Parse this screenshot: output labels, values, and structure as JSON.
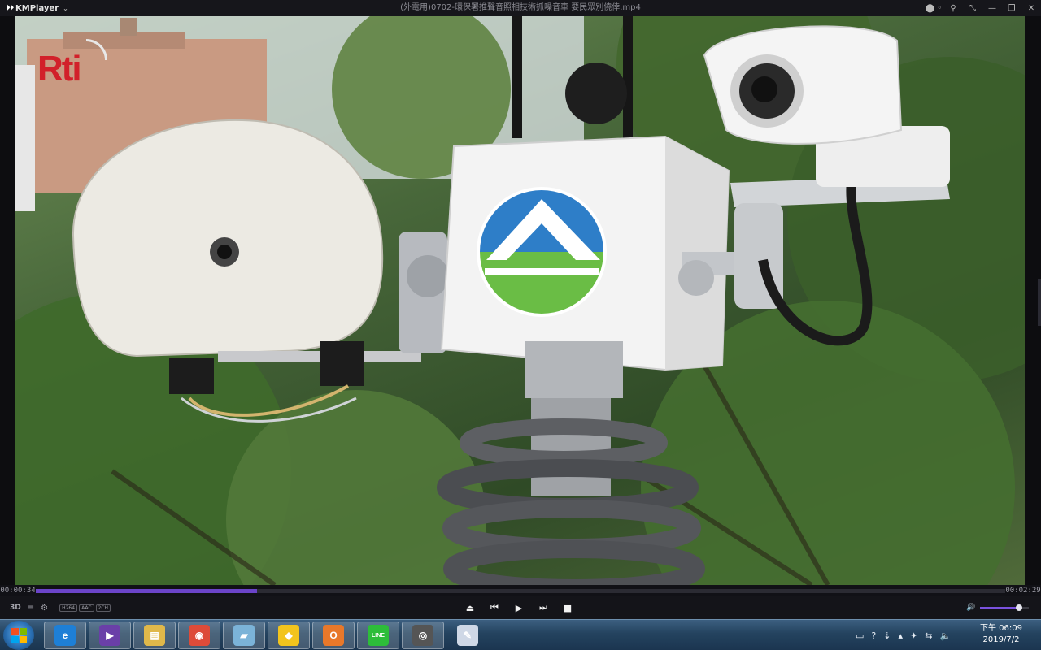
{
  "app": {
    "brand": "KMPlayer",
    "logo_glyph": "⏵⏵",
    "title": "(外電用)0702-環保署推聲音照相技術抓噪音車 要民眾別僥倖.mp4",
    "window_controls": [
      "⬤ ◦",
      "⚲",
      "⤡",
      "—",
      "❐",
      "✕"
    ]
  },
  "video": {
    "watermark": "Rti",
    "scene": "environmental noise camera mast"
  },
  "playback": {
    "current_time": "00:00:34",
    "total_time": "00:02:29",
    "progress": 0.228,
    "volume": 0.8
  },
  "controls": {
    "left": {
      "mode_3d": "3D",
      "playlist": "≡",
      "settings": "⚙",
      "codecs": [
        "H264",
        "AAC",
        "2CH"
      ]
    },
    "center": [
      "⏏",
      "⏮",
      "▶",
      "⏭",
      "■"
    ],
    "volume_icon": "🔊"
  },
  "taskbar": {
    "apps": [
      {
        "name": "ie",
        "glyph": "e",
        "color": "#1e7fd6"
      },
      {
        "name": "kmplayer",
        "glyph": "▶",
        "color": "#6a3fa8"
      },
      {
        "name": "explorer",
        "glyph": "▤",
        "color": "#e0b84a"
      },
      {
        "name": "chrome",
        "glyph": "◉",
        "color": "#dd4b39"
      },
      {
        "name": "media",
        "glyph": "▰",
        "color": "#7bb3d8"
      },
      {
        "name": "potplayer",
        "glyph": "◆",
        "color": "#f2c41d"
      },
      {
        "name": "outlook",
        "glyph": "O",
        "color": "#e8782a"
      },
      {
        "name": "line",
        "glyph": "LINE",
        "color": "#2dbd3a"
      },
      {
        "name": "viewer",
        "glyph": "◎",
        "color": "#555555"
      },
      {
        "name": "paint",
        "glyph": "✎",
        "color": "#cfd8e6"
      }
    ],
    "tray": [
      "▭",
      "?",
      "⇣",
      "▴",
      "✦",
      "⇆",
      "🔈"
    ],
    "clock_time": "下午 06:09",
    "clock_date": "2019/7/2"
  },
  "colors": {
    "accent": "#6b44c9",
    "titlebar": "#16161b",
    "taskbar": "#24435f"
  }
}
